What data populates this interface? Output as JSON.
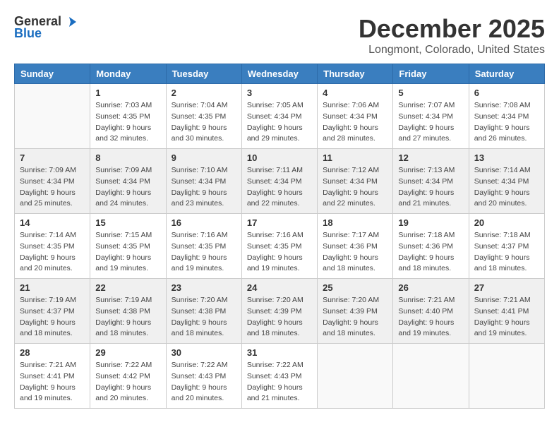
{
  "header": {
    "logo_general": "General",
    "logo_blue": "Blue",
    "month": "December 2025",
    "location": "Longmont, Colorado, United States"
  },
  "days_of_week": [
    "Sunday",
    "Monday",
    "Tuesday",
    "Wednesday",
    "Thursday",
    "Friday",
    "Saturday"
  ],
  "weeks": [
    [
      {
        "day": "",
        "info": ""
      },
      {
        "day": "1",
        "info": "Sunrise: 7:03 AM\nSunset: 4:35 PM\nDaylight: 9 hours\nand 32 minutes."
      },
      {
        "day": "2",
        "info": "Sunrise: 7:04 AM\nSunset: 4:35 PM\nDaylight: 9 hours\nand 30 minutes."
      },
      {
        "day": "3",
        "info": "Sunrise: 7:05 AM\nSunset: 4:34 PM\nDaylight: 9 hours\nand 29 minutes."
      },
      {
        "day": "4",
        "info": "Sunrise: 7:06 AM\nSunset: 4:34 PM\nDaylight: 9 hours\nand 28 minutes."
      },
      {
        "day": "5",
        "info": "Sunrise: 7:07 AM\nSunset: 4:34 PM\nDaylight: 9 hours\nand 27 minutes."
      },
      {
        "day": "6",
        "info": "Sunrise: 7:08 AM\nSunset: 4:34 PM\nDaylight: 9 hours\nand 26 minutes."
      }
    ],
    [
      {
        "day": "7",
        "info": "Sunrise: 7:09 AM\nSunset: 4:34 PM\nDaylight: 9 hours\nand 25 minutes."
      },
      {
        "day": "8",
        "info": "Sunrise: 7:09 AM\nSunset: 4:34 PM\nDaylight: 9 hours\nand 24 minutes."
      },
      {
        "day": "9",
        "info": "Sunrise: 7:10 AM\nSunset: 4:34 PM\nDaylight: 9 hours\nand 23 minutes."
      },
      {
        "day": "10",
        "info": "Sunrise: 7:11 AM\nSunset: 4:34 PM\nDaylight: 9 hours\nand 22 minutes."
      },
      {
        "day": "11",
        "info": "Sunrise: 7:12 AM\nSunset: 4:34 PM\nDaylight: 9 hours\nand 22 minutes."
      },
      {
        "day": "12",
        "info": "Sunrise: 7:13 AM\nSunset: 4:34 PM\nDaylight: 9 hours\nand 21 minutes."
      },
      {
        "day": "13",
        "info": "Sunrise: 7:14 AM\nSunset: 4:34 PM\nDaylight: 9 hours\nand 20 minutes."
      }
    ],
    [
      {
        "day": "14",
        "info": "Sunrise: 7:14 AM\nSunset: 4:35 PM\nDaylight: 9 hours\nand 20 minutes."
      },
      {
        "day": "15",
        "info": "Sunrise: 7:15 AM\nSunset: 4:35 PM\nDaylight: 9 hours\nand 19 minutes."
      },
      {
        "day": "16",
        "info": "Sunrise: 7:16 AM\nSunset: 4:35 PM\nDaylight: 9 hours\nand 19 minutes."
      },
      {
        "day": "17",
        "info": "Sunrise: 7:16 AM\nSunset: 4:35 PM\nDaylight: 9 hours\nand 19 minutes."
      },
      {
        "day": "18",
        "info": "Sunrise: 7:17 AM\nSunset: 4:36 PM\nDaylight: 9 hours\nand 18 minutes."
      },
      {
        "day": "19",
        "info": "Sunrise: 7:18 AM\nSunset: 4:36 PM\nDaylight: 9 hours\nand 18 minutes."
      },
      {
        "day": "20",
        "info": "Sunrise: 7:18 AM\nSunset: 4:37 PM\nDaylight: 9 hours\nand 18 minutes."
      }
    ],
    [
      {
        "day": "21",
        "info": "Sunrise: 7:19 AM\nSunset: 4:37 PM\nDaylight: 9 hours\nand 18 minutes."
      },
      {
        "day": "22",
        "info": "Sunrise: 7:19 AM\nSunset: 4:38 PM\nDaylight: 9 hours\nand 18 minutes."
      },
      {
        "day": "23",
        "info": "Sunrise: 7:20 AM\nSunset: 4:38 PM\nDaylight: 9 hours\nand 18 minutes."
      },
      {
        "day": "24",
        "info": "Sunrise: 7:20 AM\nSunset: 4:39 PM\nDaylight: 9 hours\nand 18 minutes."
      },
      {
        "day": "25",
        "info": "Sunrise: 7:20 AM\nSunset: 4:39 PM\nDaylight: 9 hours\nand 18 minutes."
      },
      {
        "day": "26",
        "info": "Sunrise: 7:21 AM\nSunset: 4:40 PM\nDaylight: 9 hours\nand 19 minutes."
      },
      {
        "day": "27",
        "info": "Sunrise: 7:21 AM\nSunset: 4:41 PM\nDaylight: 9 hours\nand 19 minutes."
      }
    ],
    [
      {
        "day": "28",
        "info": "Sunrise: 7:21 AM\nSunset: 4:41 PM\nDaylight: 9 hours\nand 19 minutes."
      },
      {
        "day": "29",
        "info": "Sunrise: 7:22 AM\nSunset: 4:42 PM\nDaylight: 9 hours\nand 20 minutes."
      },
      {
        "day": "30",
        "info": "Sunrise: 7:22 AM\nSunset: 4:43 PM\nDaylight: 9 hours\nand 20 minutes."
      },
      {
        "day": "31",
        "info": "Sunrise: 7:22 AM\nSunset: 4:43 PM\nDaylight: 9 hours\nand 21 minutes."
      },
      {
        "day": "",
        "info": ""
      },
      {
        "day": "",
        "info": ""
      },
      {
        "day": "",
        "info": ""
      }
    ]
  ]
}
